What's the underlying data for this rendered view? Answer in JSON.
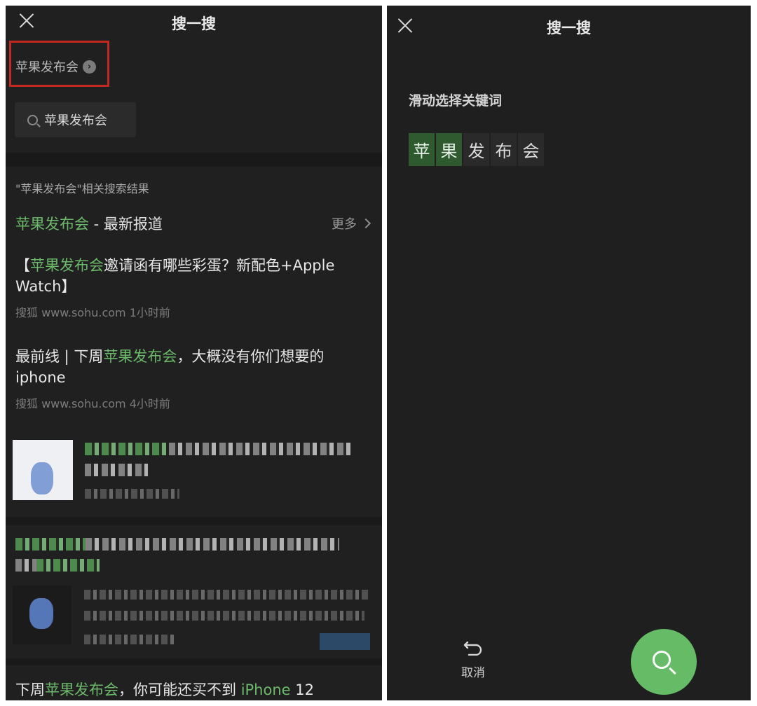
{
  "left": {
    "title": "搜一搜",
    "breadcrumb": "苹果发布会",
    "search_chip": "苹果发布会",
    "related_label": "\"苹果发布会\"相关搜索结果",
    "news_head": {
      "keyword": "苹果发布会",
      "rest": " - 最新报道",
      "more": "更多"
    },
    "articles": [
      {
        "pre": "【",
        "kw": "苹果发布会",
        "post": "邀请函有哪些彩蛋？新配色+Apple Watch】",
        "meta": "搜狐 www.sohu.com  1小时前"
      },
      {
        "pre": "最前线 | 下周",
        "kw": "苹果发布会",
        "post": "，大概没有你们想要的 iphone",
        "meta": "搜狐 www.sohu.com  4小时前"
      }
    ],
    "bottom_article": {
      "pre": "下周",
      "kw": "苹果发布会",
      "mid": "，你可能还买不到 ",
      "kw2": "iPhone",
      "post": " 12"
    }
  },
  "right": {
    "title": "搜一搜",
    "keyword_label": "滑动选择关键词",
    "chars": [
      {
        "c": "苹",
        "selected": true
      },
      {
        "c": "果",
        "selected": true
      },
      {
        "c": "发",
        "selected": false
      },
      {
        "c": "布",
        "selected": false
      },
      {
        "c": "会",
        "selected": false
      }
    ],
    "cancel_label": "取消"
  },
  "colors": {
    "accent_green": "#66bb66",
    "highlight_text": "#6cb86b",
    "callout_red": "#c1281f"
  }
}
